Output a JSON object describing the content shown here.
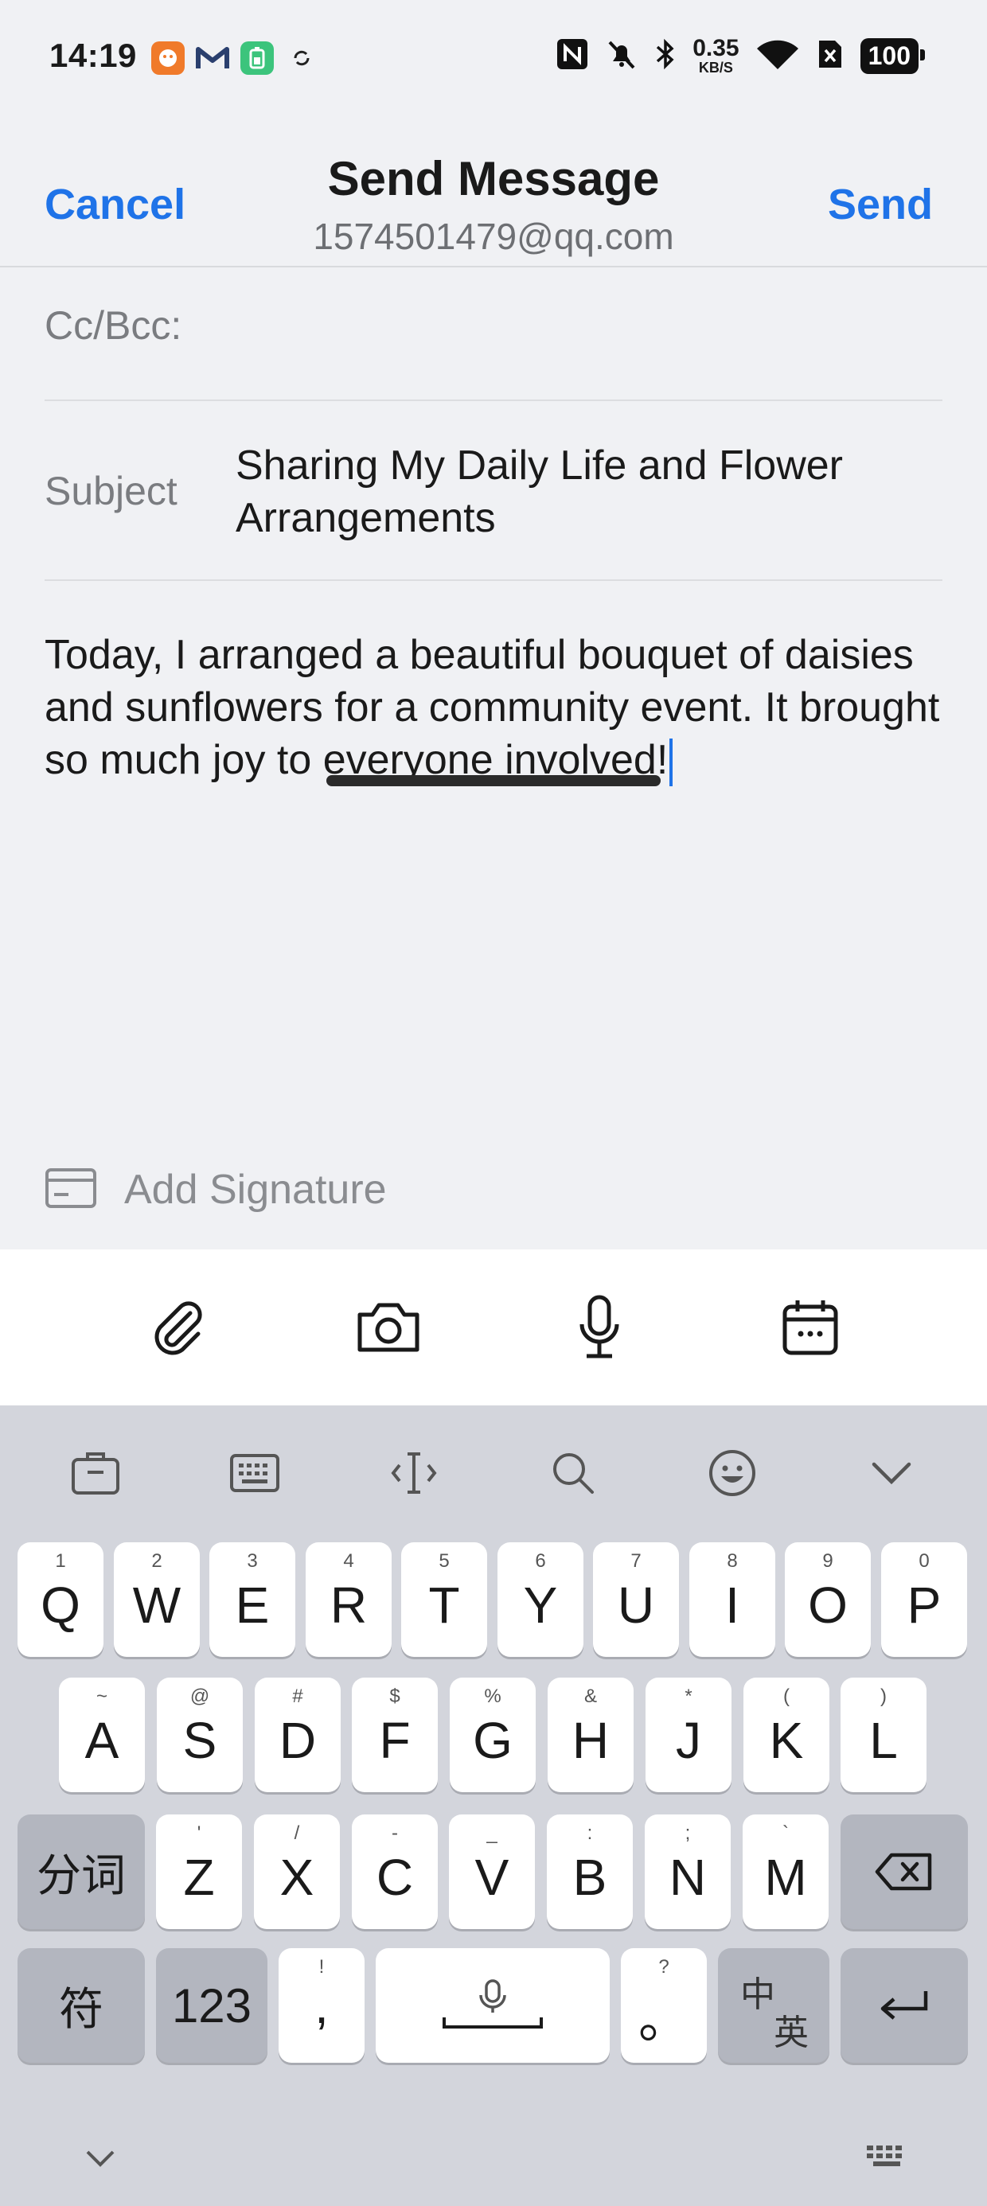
{
  "status_bar": {
    "time": "14:19",
    "speed_value": "0.35",
    "speed_unit": "KB/S",
    "battery": "100"
  },
  "header": {
    "cancel_label": "Cancel",
    "title": "Send Message",
    "sender": "1574501479@qq.com",
    "send_label": "Send"
  },
  "form": {
    "cc_label": "Cc/Bcc:",
    "subject_label": "Subject",
    "subject_value": "Sharing My Daily Life and Flower Arrangements",
    "body_value": "Today, I arranged a beautiful bouquet of daisies and sunflowers for a community event. It brought so much joy to everyone involved!",
    "signature_label": "Add Signature"
  },
  "toolbar": {
    "icons": [
      "paperclip-icon",
      "camera-icon",
      "microphone-icon",
      "calendar-icon"
    ]
  },
  "keyboard": {
    "row1": [
      {
        "k": "Q",
        "h": "1"
      },
      {
        "k": "W",
        "h": "2"
      },
      {
        "k": "E",
        "h": "3"
      },
      {
        "k": "R",
        "h": "4"
      },
      {
        "k": "T",
        "h": "5"
      },
      {
        "k": "Y",
        "h": "6"
      },
      {
        "k": "U",
        "h": "7"
      },
      {
        "k": "I",
        "h": "8"
      },
      {
        "k": "O",
        "h": "9"
      },
      {
        "k": "P",
        "h": "0"
      }
    ],
    "row2": [
      {
        "k": "A",
        "h": "~"
      },
      {
        "k": "S",
        "h": "@"
      },
      {
        "k": "D",
        "h": "#"
      },
      {
        "k": "F",
        "h": "$"
      },
      {
        "k": "G",
        "h": "%"
      },
      {
        "k": "H",
        "h": "&"
      },
      {
        "k": "J",
        "h": "*"
      },
      {
        "k": "K",
        "h": "("
      },
      {
        "k": "L",
        "h": ")"
      }
    ],
    "row3": [
      {
        "k": "Z",
        "h": "'"
      },
      {
        "k": "X",
        "h": "/"
      },
      {
        "k": "C",
        "h": "-"
      },
      {
        "k": "V",
        "h": "_"
      },
      {
        "k": "B",
        "h": ":"
      },
      {
        "k": "N",
        "h": ";"
      },
      {
        "k": "M",
        "h": "`"
      }
    ],
    "segment_label": "分词",
    "symbols_label": "符",
    "numbers_label": "123",
    "comma_key": ",",
    "comma_hint": "!",
    "period_key": "。",
    "period_hint": "?",
    "lang_label_zh": "中",
    "lang_label_en": "英"
  }
}
